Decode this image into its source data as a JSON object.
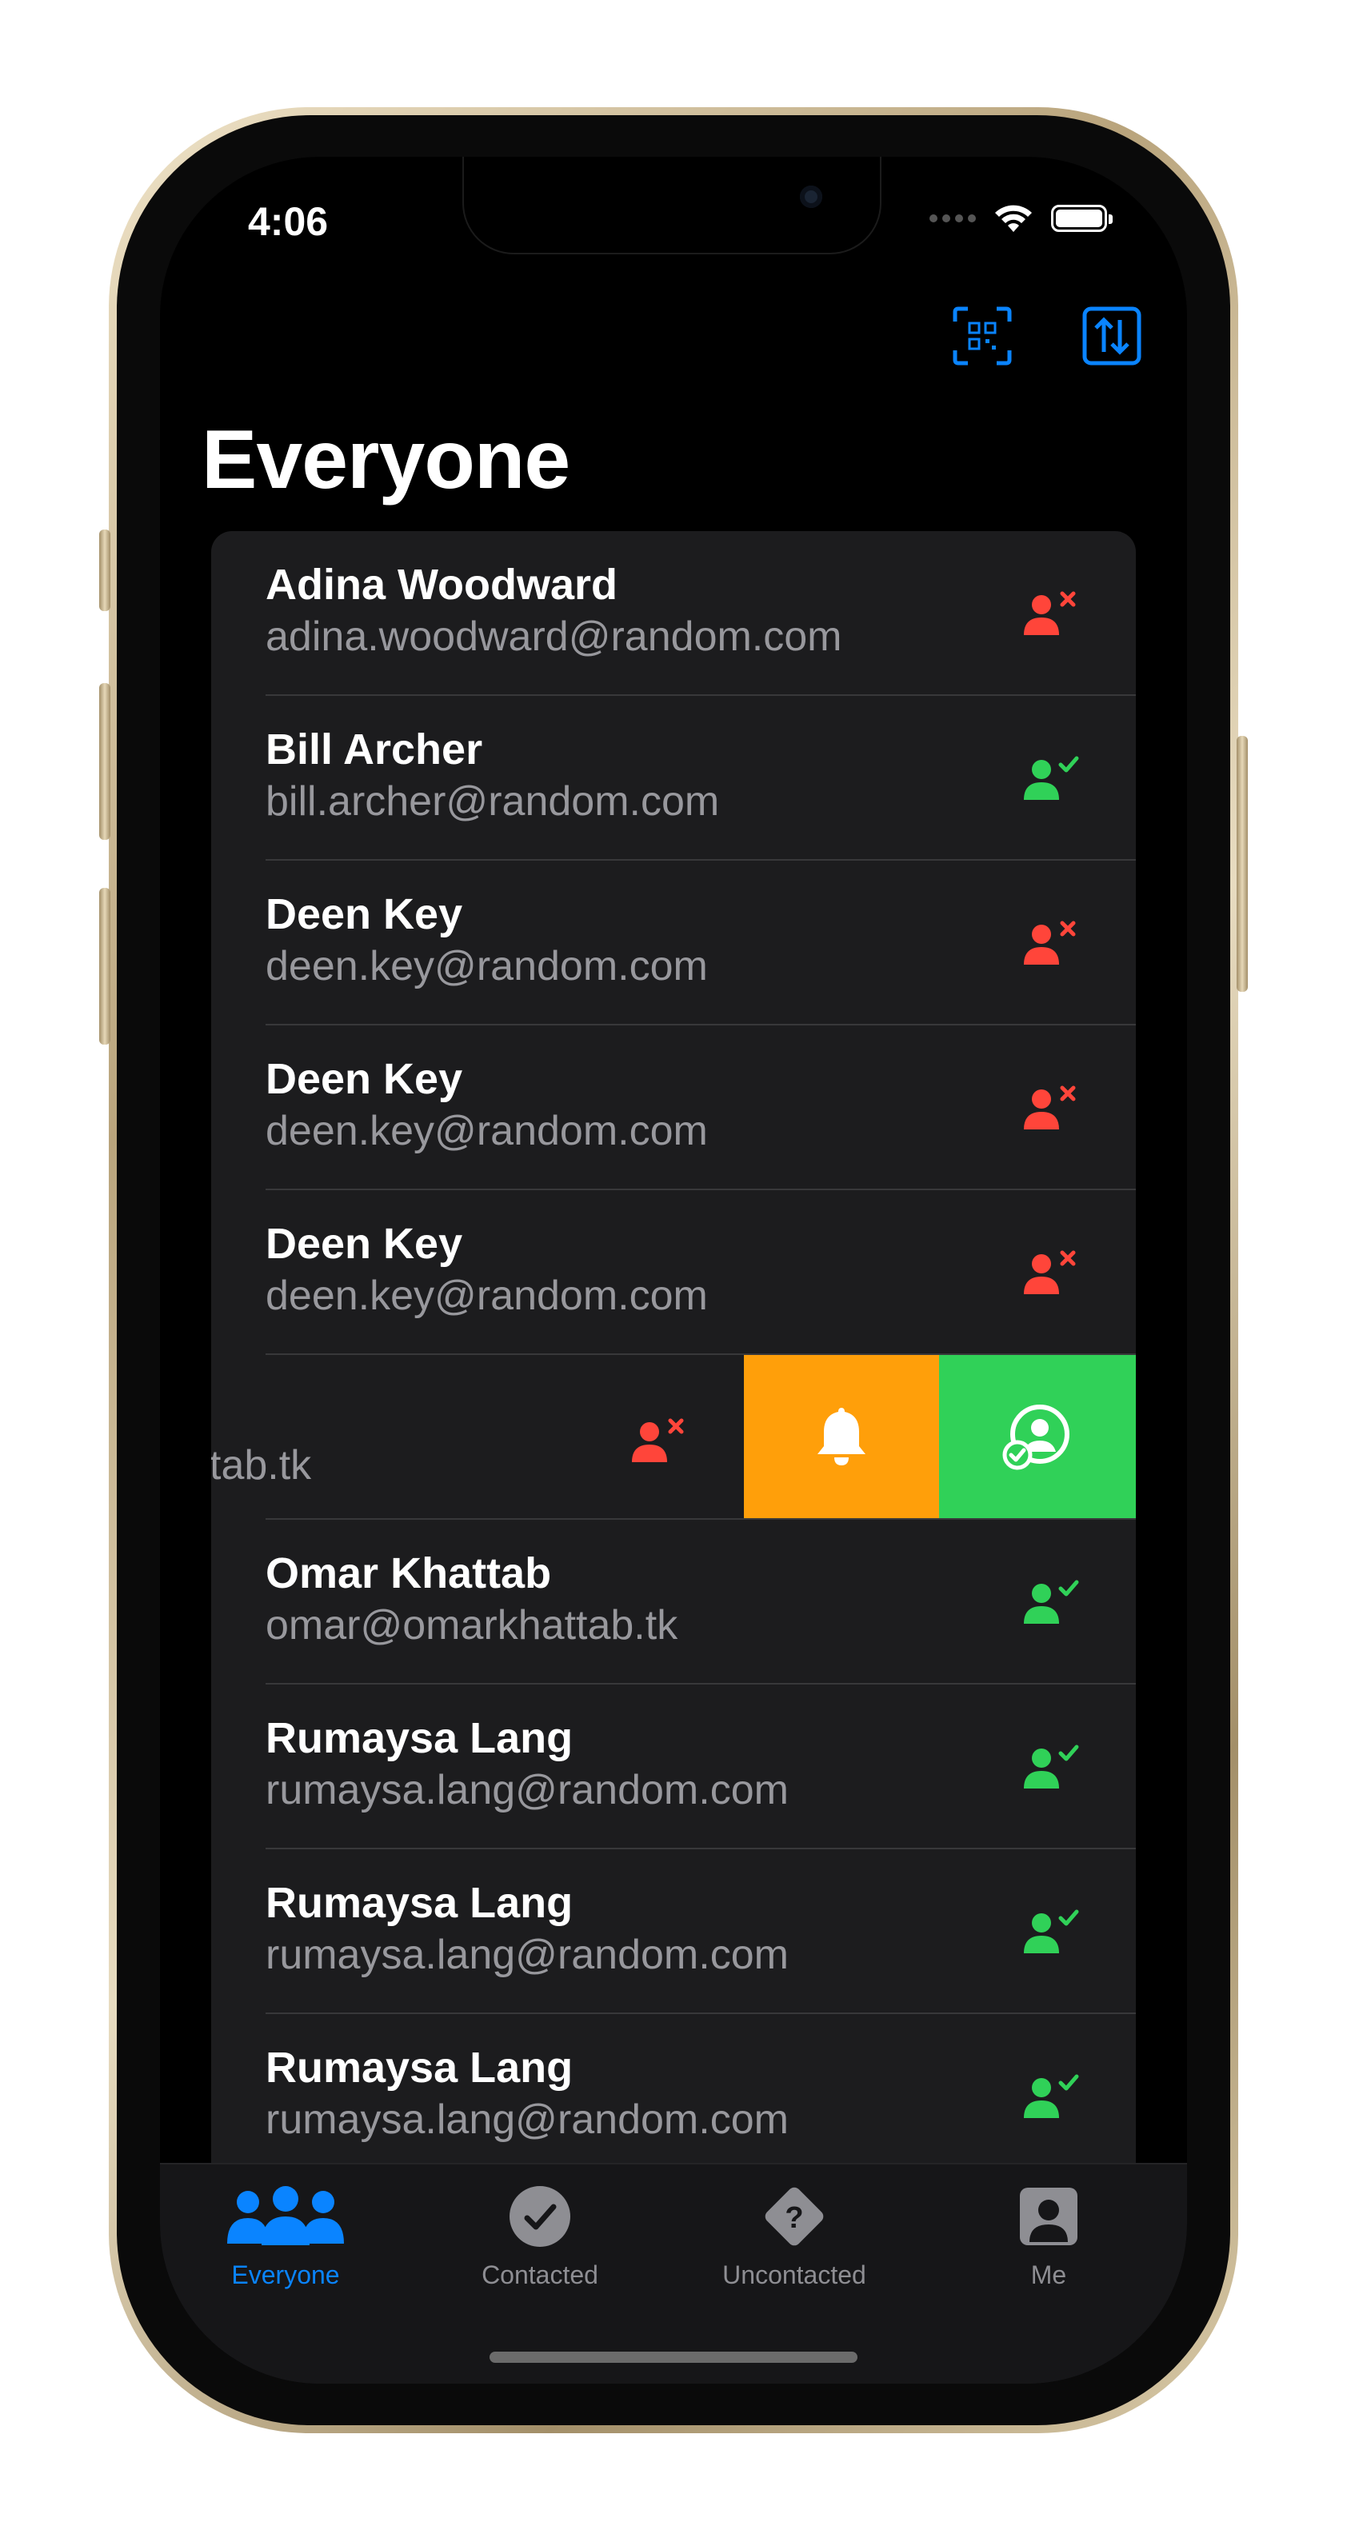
{
  "status_bar": {
    "time": "4:06"
  },
  "header": {
    "title": "Everyone",
    "qr_icon": "qr-scan-icon",
    "sort_icon": "sort-icon"
  },
  "colors": {
    "accent": "#0a84ff",
    "uncontacted": "#ff453a",
    "contacted": "#30d158",
    "notify_action": "#ff9f0a",
    "list_bg": "#1c1c1e"
  },
  "people": [
    {
      "name": "Adina Woodward",
      "email": "adina.woodward@random.com",
      "status": "uncontacted"
    },
    {
      "name": "Bill Archer",
      "email": "bill.archer@random.com",
      "status": "contacted"
    },
    {
      "name": "Deen Key",
      "email": "deen.key@random.com",
      "status": "uncontacted"
    },
    {
      "name": "Deen Key",
      "email": "deen.key@random.com",
      "status": "uncontacted"
    },
    {
      "name": "Deen Key",
      "email": "deen.key@random.com",
      "status": "uncontacted"
    }
  ],
  "swiped_row": {
    "email_fragment": "tab.tk",
    "status": "uncontacted",
    "actions": [
      "bell-icon",
      "mark-contacted-icon"
    ]
  },
  "people_after": [
    {
      "name": "Omar Khattab",
      "email": "omar@omarkhattab.tk",
      "status": "contacted"
    },
    {
      "name": "Rumaysa Lang",
      "email": "rumaysa.lang@random.com",
      "status": "contacted"
    },
    {
      "name": "Rumaysa Lang",
      "email": "rumaysa.lang@random.com",
      "status": "contacted"
    },
    {
      "name": "Rumaysa Lang",
      "email": "rumaysa.lang@random.com",
      "status": "contacted"
    }
  ],
  "tabs": [
    {
      "label": "Everyone",
      "icon": "people-icon",
      "active": true
    },
    {
      "label": "Contacted",
      "icon": "checkmark-circle-icon",
      "active": false
    },
    {
      "label": "Uncontacted",
      "icon": "question-diamond-icon",
      "active": false
    },
    {
      "label": "Me",
      "icon": "person-square-icon",
      "active": false
    }
  ]
}
